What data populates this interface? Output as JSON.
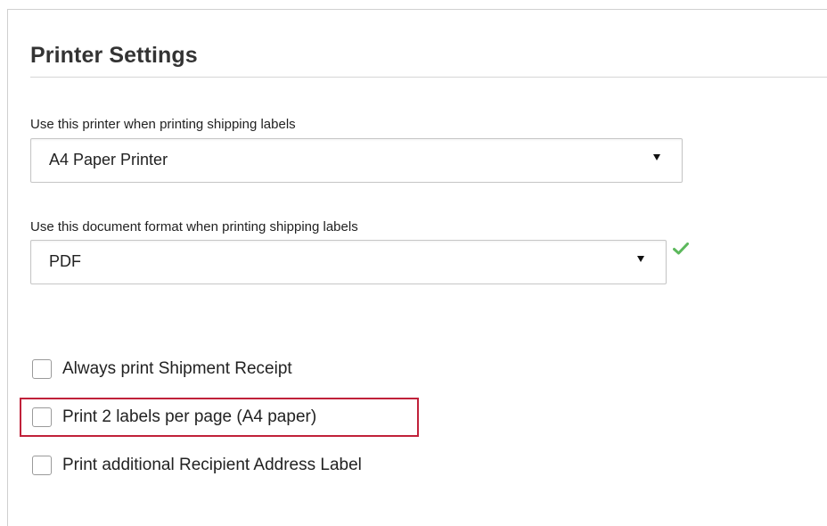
{
  "section": {
    "title": "Printer Settings"
  },
  "printer_select": {
    "label": "Use this printer when printing shipping labels",
    "value": "A4 Paper Printer"
  },
  "format_select": {
    "label": "Use this document format when printing shipping labels",
    "value": "PDF",
    "status_icon": "check-icon",
    "status_color": "#5cb85c"
  },
  "options": [
    {
      "label": "Always print Shipment Receipt",
      "checked": false
    },
    {
      "label": "Print 2 labels per page (A4 paper)",
      "checked": false,
      "highlighted": true
    },
    {
      "label": "Print additional Recipient Address Label",
      "checked": false
    }
  ],
  "highlight_color": "#c0213a"
}
